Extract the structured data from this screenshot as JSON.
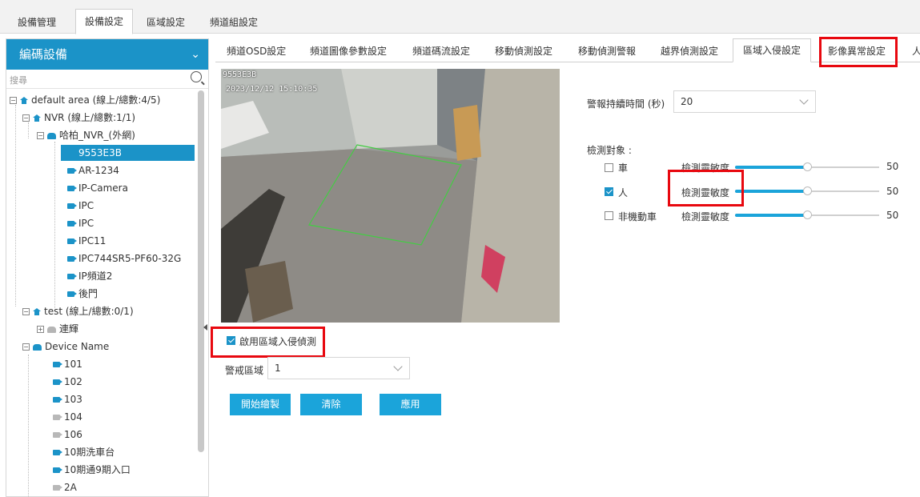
{
  "top_tabs": [
    "設備管理",
    "設備設定",
    "區域設定",
    "頻道組設定"
  ],
  "active_top_tab": "設備設定",
  "sidebar": {
    "title": "編碼設備",
    "search_placeholder": "搜尋",
    "tree": {
      "default_area": "default area (線上/總數:4/5)",
      "nvr": "NVR (線上/總數:1/1)",
      "nvr_child": "哈柏_NVR_(外網)",
      "selected": "9553E3B",
      "cams1": [
        "AR-1234",
        "IP-Camera",
        "IPC",
        "IPC",
        "IPC11",
        "IPC744SR5-PF60-32G",
        "IP頻道2",
        "後門"
      ],
      "test": "test (線上/總數:0/1)",
      "test_child": "連輝",
      "device_name": "Device Name",
      "cams2": [
        "101",
        "102",
        "103",
        "104",
        "106",
        "10期洗車台",
        "10期通9期入口",
        "2A"
      ]
    }
  },
  "sub_tabs": [
    "頻道OSD設定",
    "頻道圖像參數設定",
    "頻道碼流設定",
    "移動偵測設定",
    "移動偵測警報",
    "越界偵測設定",
    "區域入侵設定",
    "影像異常設定",
    "人"
  ],
  "active_sub_tab": "區域入侵設定",
  "video": {
    "osd_name": "9553E3B",
    "osd_time": "2023/12/12 15:10:35"
  },
  "settings": {
    "alarm_duration_label": "警報持續時間 (秒)",
    "alarm_duration_value": "20",
    "detect_target_label": "檢測對象 :",
    "targets": [
      {
        "name": "車",
        "checked": false,
        "sens_label": "檢測靈敏度",
        "value": "50",
        "level": 0.5
      },
      {
        "name": "人",
        "checked": true,
        "sens_label": "檢測靈敏度",
        "value": "50",
        "level": 0.5
      },
      {
        "name": "非機動車",
        "checked": false,
        "sens_label": "檢測靈敏度",
        "value": "50",
        "level": 0.5
      }
    ]
  },
  "enable_label": "啟用區域入侵偵測",
  "enable_checked": true,
  "zone_label": "警戒區域",
  "zone_value": "1",
  "buttons": {
    "draw": "開始繪製",
    "clear": "清除",
    "apply": "應用"
  },
  "colors": {
    "accent": "#1b93c8",
    "button": "#1ba4da",
    "highlight": "#e8080f",
    "zone_line": "#44cc44"
  }
}
